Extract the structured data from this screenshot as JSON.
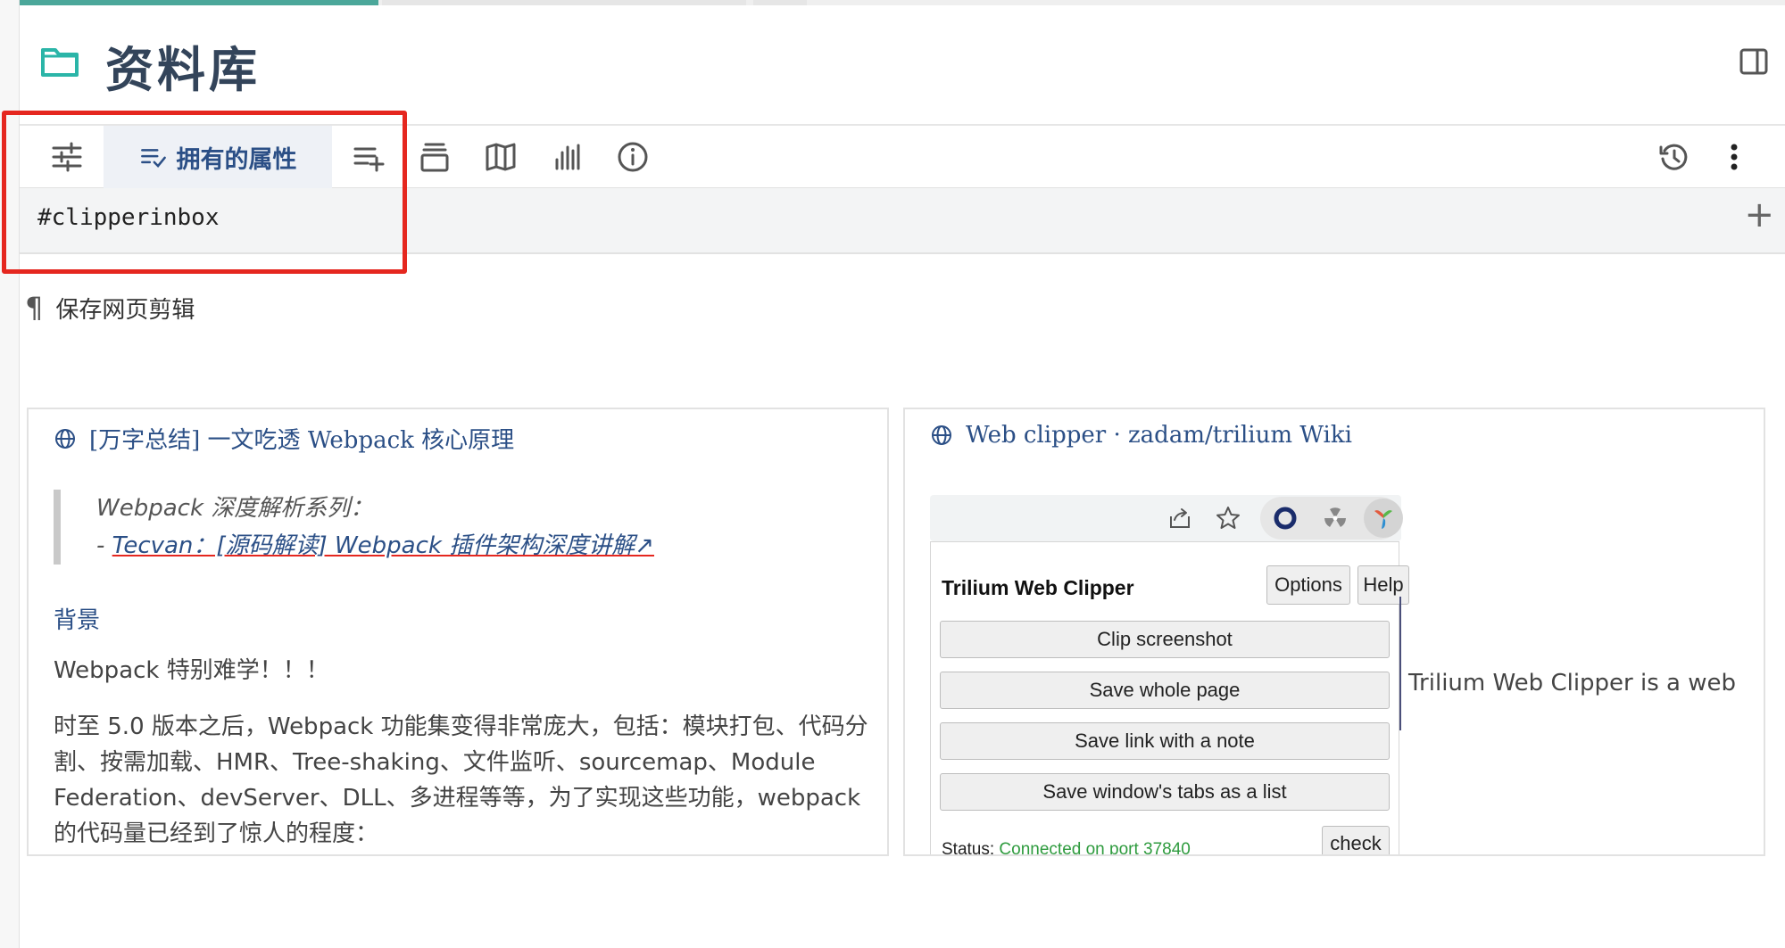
{
  "note": {
    "title": "资料库",
    "icon": "folder-icon"
  },
  "ribbon": {
    "active_tab_label": "拥有的属性",
    "buttons": [
      "settings-sliders-icon",
      "owned-attributes-icon",
      "inherited-attributes-icon",
      "note-paths-icon",
      "note-map-icon",
      "similar-notes-icon",
      "note-info-icon",
      "revisions-icon",
      "more-menu-icon"
    ]
  },
  "attributes": {
    "value": "#clipperinbox",
    "add_symbol": "+"
  },
  "content": {
    "pilcrow": "¶",
    "paragraph": "保存网页剪辑"
  },
  "cards": [
    {
      "title": "[万字总结] 一文吃透 Webpack 核心原理",
      "quote_line1": "Webpack 深度解析系列：",
      "quote_prefix": "- ",
      "quote_link": "Tecvan：[源码解读] Webpack 插件架构深度讲解↗",
      "section": "背景",
      "p1": "Webpack 特别难学！！！",
      "p2": "时至 5.0 版本之后，Webpack 功能集变得非常庞大，包括：模块打包、代码分割、按需加载、HMR、Tree-shaking、文件监听、sourcemap、Module Federation、devServer、DLL、多进程等等，为了实现这些功能，webpack 的代码量已经到了惊人的程度："
    },
    {
      "title": "Web clipper · zadam/trilium Wiki",
      "popup": {
        "title": "Trilium Web Clipper",
        "options": "Options",
        "help": "Help",
        "buttons": [
          "Clip screenshot",
          "Save whole page",
          "Save link with a note",
          "Save window's tabs as a list"
        ],
        "status_label": "Status: ",
        "status_value": "Connected on port 37840",
        "check": "check"
      },
      "side_text": "Trilium Web Clipper is a web"
    }
  ],
  "colors": {
    "accent": "#4ba79a",
    "title": "#33445a",
    "link": "#2b4f86",
    "highlight": "#e5271f",
    "status_ok": "#2e9b3e"
  }
}
